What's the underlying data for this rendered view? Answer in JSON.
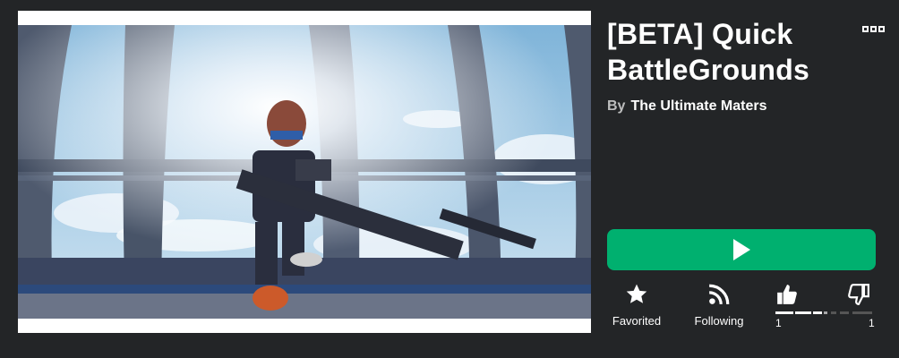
{
  "game": {
    "title": "[BETA] Quick BattleGrounds",
    "by_label": "By",
    "creator": "The Ultimate Maters"
  },
  "thumbnail": {
    "description_icon": "game-thumbnail"
  },
  "actions": {
    "favorite_label": "Favorited",
    "follow_label": "Following",
    "upvotes": "1",
    "downvotes": "1",
    "vote_ratio": 0.5
  },
  "colors": {
    "background": "#232527",
    "play_button": "#00b06f",
    "text": "#ffffff",
    "subtext": "#bdbebe"
  },
  "icons": {
    "more": "more-options-icon",
    "play": "play-icon",
    "favorite": "star-icon",
    "follow": "rss-icon",
    "upvote": "thumbs-up-icon",
    "downvote": "thumbs-down-icon"
  }
}
